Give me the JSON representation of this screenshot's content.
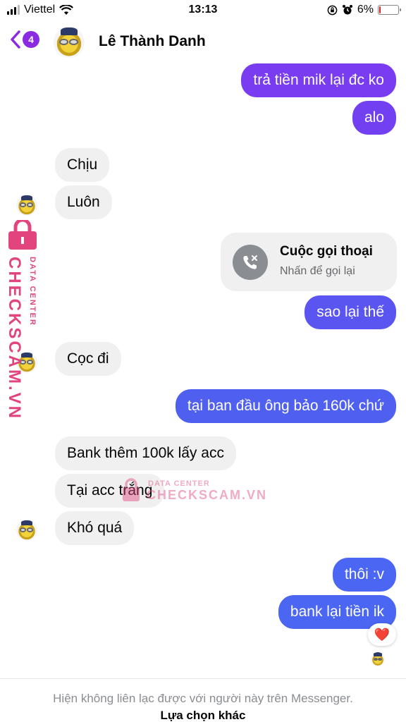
{
  "status_bar": {
    "carrier": "Viettel",
    "time": "13:13",
    "battery": "6%"
  },
  "header": {
    "back_count": "4",
    "contact_name": "Lê Thành Danh"
  },
  "messages": {
    "out_1": "trả tiền mik lại đc ko",
    "out_2": "alo",
    "in_1": "Chịu",
    "in_2": "Luôn",
    "call_title": "Cuộc gọi thoại",
    "call_subtitle": "Nhấn để gọi lại",
    "out_3": "sao lại thế",
    "in_3": "Cọc đi",
    "out_4": "tại ban đầu ông bảo 160k chứ",
    "in_4": "Bank thêm 100k lấy acc",
    "in_5": "Tại acc trắng",
    "in_6": "Khó quá",
    "out_5": "thôi :v",
    "out_6": "bank lại tiền ik",
    "reaction": "❤️"
  },
  "footer": {
    "notice": "Hiện không liên lạc được với người này trên Messenger.",
    "option": "Lựa chọn khác"
  },
  "watermark": {
    "brand": "CHECKSCAM.VN",
    "tag": "DATA CENTER"
  },
  "colors": {
    "outgoing_top": "#7a3cf0",
    "outgoing_bottom": "#4a66f2",
    "incoming": "#f0f0f0",
    "badge": "#8a2be2",
    "watermark": "#e2457d"
  }
}
